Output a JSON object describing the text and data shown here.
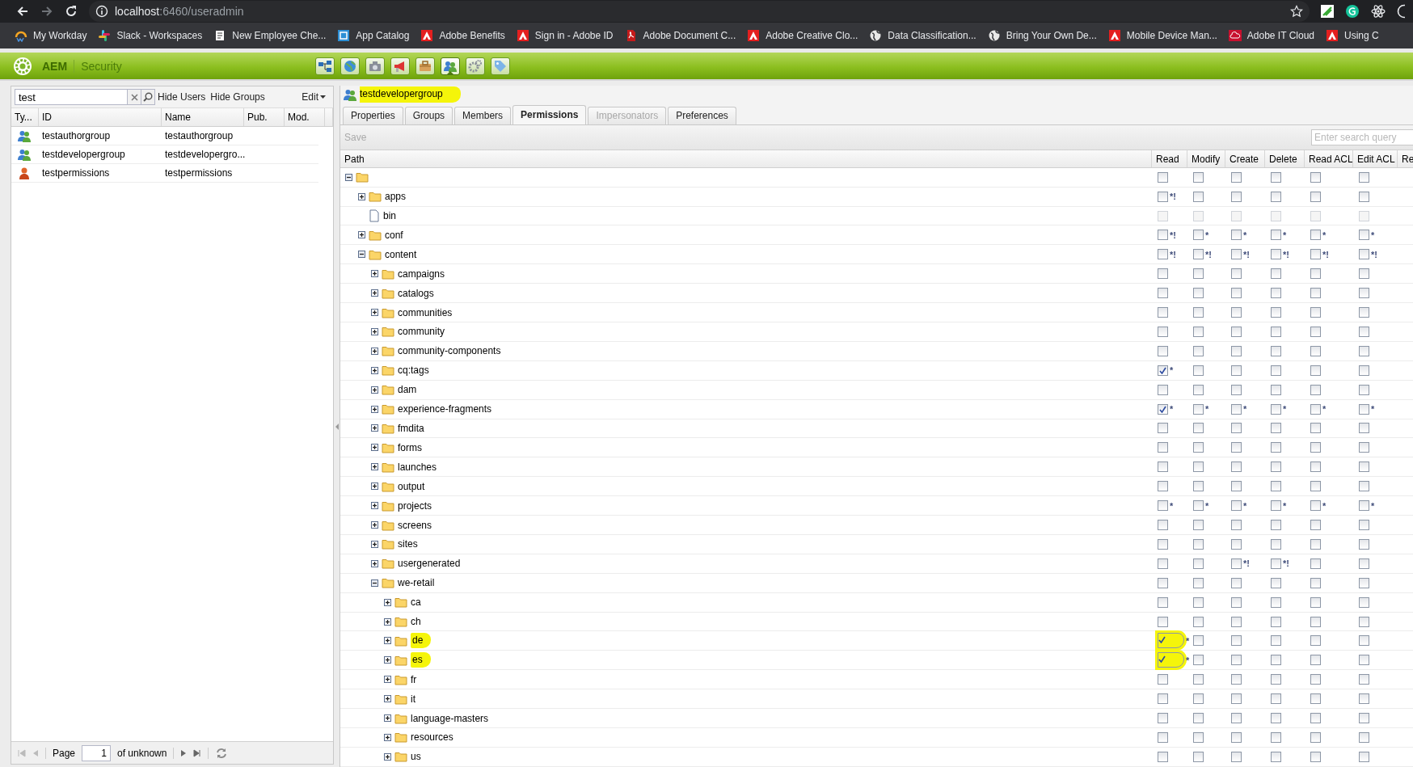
{
  "browser": {
    "url_host": "localhost",
    "url_path": ":6460/useradmin",
    "bookmarks": [
      {
        "label": "My Workday",
        "kind": "workday"
      },
      {
        "label": "Slack - Workspaces",
        "kind": "slack"
      },
      {
        "label": "New Employee Che...",
        "kind": "page"
      },
      {
        "label": "App Catalog",
        "kind": "catalog"
      },
      {
        "label": "Adobe Benefits",
        "kind": "adobe"
      },
      {
        "label": "Sign in - Adobe ID",
        "kind": "adobe"
      },
      {
        "label": "Adobe Document C...",
        "kind": "pdf"
      },
      {
        "label": "Adobe Creative Clo...",
        "kind": "adobe"
      },
      {
        "label": "Data Classification...",
        "kind": "globe"
      },
      {
        "label": "Bring Your Own De...",
        "kind": "globe"
      },
      {
        "label": "Mobile Device Man...",
        "kind": "adobe"
      },
      {
        "label": "Adobe IT Cloud",
        "kind": "cloud"
      },
      {
        "label": "Using C",
        "kind": "adobe"
      }
    ]
  },
  "app_bar": {
    "logo": "AEM",
    "section": "Security",
    "tools": [
      {
        "kind": "network",
        "selected": false
      },
      {
        "kind": "globe",
        "selected": false
      },
      {
        "kind": "camera",
        "selected": false
      },
      {
        "kind": "megaphone",
        "selected": false
      },
      {
        "kind": "envelope",
        "selected": false
      },
      {
        "kind": "users",
        "selected": true
      },
      {
        "kind": "gears",
        "selected": false
      },
      {
        "kind": "tag",
        "selected": false
      }
    ]
  },
  "user_list": {
    "search": {
      "value": "test"
    },
    "filters": [
      "Hide Users",
      "Hide Groups"
    ],
    "edit_menu": "Edit",
    "columns": [
      "Ty...",
      "ID",
      "Name",
      "Pub.",
      "Mod."
    ],
    "rows": [
      {
        "kind": "group",
        "id": "testauthorgroup",
        "name": "testauthorgroup"
      },
      {
        "kind": "group",
        "id": "testdevelopergroup",
        "name": "testdevelopergro..."
      },
      {
        "kind": "user",
        "id": "testpermissions",
        "name": "testpermissions"
      }
    ],
    "pager": {
      "label": "Page",
      "page": "1",
      "total": "of unknown"
    }
  },
  "editor": {
    "title": "testdevelopergroup",
    "title_highlighted": true,
    "tabs": [
      {
        "label": "Properties",
        "selected": false,
        "disabled": false
      },
      {
        "label": "Groups",
        "selected": false,
        "disabled": false
      },
      {
        "label": "Members",
        "selected": false,
        "disabled": false
      },
      {
        "label": "Permissions",
        "selected": true,
        "disabled": false
      },
      {
        "label": "Impersonators",
        "selected": false,
        "disabled": true
      },
      {
        "label": "Preferences",
        "selected": false,
        "disabled": false
      }
    ],
    "save": {
      "label": "Save",
      "disabled": true
    },
    "search": {
      "placeholder": "Enter search query"
    },
    "columns": [
      "Path",
      "Read",
      "Modify",
      "Create",
      "Delete",
      "Read ACL",
      "Edit ACL",
      "Re"
    ],
    "tree": {
      "kind": "folder",
      "expanded": true,
      "highlighted": false,
      "disabled": false,
      "permissions": [
        {
          "checked": false
        },
        {
          "checked": false
        },
        {
          "checked": false
        },
        {
          "checked": false
        },
        {
          "checked": false
        },
        {
          "checked": false
        }
      ],
      "children": [
        {
          "name": "apps",
          "kind": "folder",
          "expanded": false,
          "highlighted": false,
          "disabled": false,
          "permissions": [
            {
              "checked": false,
              "note": "*!"
            },
            {
              "checked": false
            },
            {
              "checked": false
            },
            {
              "checked": false
            },
            {
              "checked": false
            },
            {
              "checked": false
            }
          ]
        },
        {
          "name": "bin",
          "kind": "file",
          "highlighted": false,
          "disabled": true,
          "permissions": [
            {
              "checked": false
            },
            {
              "checked": false
            },
            {
              "checked": false
            },
            {
              "checked": false
            },
            {
              "checked": false
            },
            {
              "checked": false
            }
          ]
        },
        {
          "name": "conf",
          "kind": "folder",
          "expanded": false,
          "highlighted": false,
          "disabled": false,
          "permissions": [
            {
              "checked": false,
              "note": "*!"
            },
            {
              "checked": false,
              "note": "*"
            },
            {
              "checked": false,
              "note": "*"
            },
            {
              "checked": false,
              "note": "*"
            },
            {
              "checked": false,
              "note": "*"
            },
            {
              "checked": false,
              "note": "*"
            }
          ]
        },
        {
          "name": "content",
          "kind": "folder",
          "expanded": true,
          "highlighted": false,
          "disabled": false,
          "permissions": [
            {
              "checked": false,
              "note": "*!"
            },
            {
              "checked": false,
              "note": "*!"
            },
            {
              "checked": false,
              "note": "*!"
            },
            {
              "checked": false,
              "note": "*!"
            },
            {
              "checked": false,
              "note": "*!"
            },
            {
              "checked": false,
              "note": "*!"
            }
          ],
          "children": [
            {
              "name": "campaigns",
              "kind": "folder",
              "expanded": false,
              "highlighted": false,
              "disabled": false,
              "permissions": [
                {
                  "checked": false
                },
                {
                  "checked": false
                },
                {
                  "checked": false
                },
                {
                  "checked": false
                },
                {
                  "checked": false
                },
                {
                  "checked": false
                }
              ]
            },
            {
              "name": "catalogs",
              "kind": "folder",
              "expanded": false,
              "highlighted": false,
              "disabled": false,
              "permissions": [
                {
                  "checked": false
                },
                {
                  "checked": false
                },
                {
                  "checked": false
                },
                {
                  "checked": false
                },
                {
                  "checked": false
                },
                {
                  "checked": false
                }
              ]
            },
            {
              "name": "communities",
              "kind": "folder",
              "expanded": false,
              "highlighted": false,
              "disabled": false,
              "permissions": [
                {
                  "checked": false
                },
                {
                  "checked": false
                },
                {
                  "checked": false
                },
                {
                  "checked": false
                },
                {
                  "checked": false
                },
                {
                  "checked": false
                }
              ]
            },
            {
              "name": "community",
              "kind": "folder",
              "expanded": false,
              "highlighted": false,
              "disabled": false,
              "permissions": [
                {
                  "checked": false
                },
                {
                  "checked": false
                },
                {
                  "checked": false
                },
                {
                  "checked": false
                },
                {
                  "checked": false
                },
                {
                  "checked": false
                }
              ]
            },
            {
              "name": "community-components",
              "kind": "folder",
              "expanded": false,
              "highlighted": false,
              "disabled": false,
              "permissions": [
                {
                  "checked": false
                },
                {
                  "checked": false
                },
                {
                  "checked": false
                },
                {
                  "checked": false
                },
                {
                  "checked": false
                },
                {
                  "checked": false
                }
              ]
            },
            {
              "name": "cq:tags",
              "kind": "folder",
              "expanded": false,
              "highlighted": false,
              "disabled": false,
              "permissions": [
                {
                  "checked": true,
                  "note": "*"
                },
                {
                  "checked": false
                },
                {
                  "checked": false
                },
                {
                  "checked": false
                },
                {
                  "checked": false
                },
                {
                  "checked": false
                }
              ]
            },
            {
              "name": "dam",
              "kind": "folder",
              "expanded": false,
              "highlighted": false,
              "disabled": false,
              "permissions": [
                {
                  "checked": false
                },
                {
                  "checked": false
                },
                {
                  "checked": false
                },
                {
                  "checked": false
                },
                {
                  "checked": false
                },
                {
                  "checked": false
                }
              ]
            },
            {
              "name": "experience-fragments",
              "kind": "folder",
              "expanded": false,
              "highlighted": false,
              "disabled": false,
              "permissions": [
                {
                  "checked": true,
                  "note": "*"
                },
                {
                  "checked": false,
                  "note": "*"
                },
                {
                  "checked": false,
                  "note": "*"
                },
                {
                  "checked": false,
                  "note": "*"
                },
                {
                  "checked": false,
                  "note": "*"
                },
                {
                  "checked": false,
                  "note": "*"
                }
              ]
            },
            {
              "name": "fmdita",
              "kind": "folder",
              "expanded": false,
              "highlighted": false,
              "disabled": false,
              "permissions": [
                {
                  "checked": false
                },
                {
                  "checked": false
                },
                {
                  "checked": false
                },
                {
                  "checked": false
                },
                {
                  "checked": false
                },
                {
                  "checked": false
                }
              ]
            },
            {
              "name": "forms",
              "kind": "folder",
              "expanded": false,
              "highlighted": false,
              "disabled": false,
              "permissions": [
                {
                  "checked": false
                },
                {
                  "checked": false
                },
                {
                  "checked": false
                },
                {
                  "checked": false
                },
                {
                  "checked": false
                },
                {
                  "checked": false
                }
              ]
            },
            {
              "name": "launches",
              "kind": "folder",
              "expanded": false,
              "highlighted": false,
              "disabled": false,
              "permissions": [
                {
                  "checked": false
                },
                {
                  "checked": false
                },
                {
                  "checked": false
                },
                {
                  "checked": false
                },
                {
                  "checked": false
                },
                {
                  "checked": false
                }
              ]
            },
            {
              "name": "output",
              "kind": "folder",
              "expanded": false,
              "highlighted": false,
              "disabled": false,
              "permissions": [
                {
                  "checked": false
                },
                {
                  "checked": false
                },
                {
                  "checked": false
                },
                {
                  "checked": false
                },
                {
                  "checked": false
                },
                {
                  "checked": false
                }
              ]
            },
            {
              "name": "projects",
              "kind": "folder",
              "expanded": false,
              "highlighted": false,
              "disabled": false,
              "permissions": [
                {
                  "checked": false,
                  "note": "*"
                },
                {
                  "checked": false,
                  "note": "*"
                },
                {
                  "checked": false,
                  "note": "*"
                },
                {
                  "checked": false,
                  "note": "*"
                },
                {
                  "checked": false,
                  "note": "*"
                },
                {
                  "checked": false,
                  "note": "*"
                }
              ]
            },
            {
              "name": "screens",
              "kind": "folder",
              "expanded": false,
              "highlighted": false,
              "disabled": false,
              "permissions": [
                {
                  "checked": false
                },
                {
                  "checked": false
                },
                {
                  "checked": false
                },
                {
                  "checked": false
                },
                {
                  "checked": false
                },
                {
                  "checked": false
                }
              ]
            },
            {
              "name": "sites",
              "kind": "folder",
              "expanded": false,
              "highlighted": false,
              "disabled": false,
              "permissions": [
                {
                  "checked": false
                },
                {
                  "checked": false
                },
                {
                  "checked": false
                },
                {
                  "checked": false
                },
                {
                  "checked": false
                },
                {
                  "checked": false
                }
              ]
            },
            {
              "name": "usergenerated",
              "kind": "folder",
              "expanded": false,
              "highlighted": false,
              "disabled": false,
              "permissions": [
                {
                  "checked": false
                },
                {
                  "checked": false
                },
                {
                  "checked": false,
                  "note": "*!"
                },
                {
                  "checked": false,
                  "note": "*!"
                },
                {
                  "checked": false
                },
                {
                  "checked": false
                }
              ]
            },
            {
              "name": "we-retail",
              "kind": "folder",
              "expanded": true,
              "highlighted": false,
              "disabled": false,
              "permissions": [
                {
                  "checked": false
                },
                {
                  "checked": false
                },
                {
                  "checked": false
                },
                {
                  "checked": false
                },
                {
                  "checked": false
                },
                {
                  "checked": false
                }
              ],
              "children": [
                {
                  "name": "ca",
                  "kind": "folder",
                  "expanded": false,
                  "highlighted": false,
                  "disabled": false,
                  "permissions": [
                    {
                      "checked": false
                    },
                    {
                      "checked": false
                    },
                    {
                      "checked": false
                    },
                    {
                      "checked": false
                    },
                    {
                      "checked": false
                    },
                    {
                      "checked": false
                    }
                  ]
                },
                {
                  "name": "ch",
                  "kind": "folder",
                  "expanded": false,
                  "highlighted": false,
                  "disabled": false,
                  "permissions": [
                    {
                      "checked": false
                    },
                    {
                      "checked": false
                    },
                    {
                      "checked": false
                    },
                    {
                      "checked": false
                    },
                    {
                      "checked": false
                    },
                    {
                      "checked": false
                    }
                  ]
                },
                {
                  "name": "de",
                  "kind": "folder",
                  "expanded": false,
                  "highlighted": true,
                  "disabled": false,
                  "permissions": [
                    {
                      "checked": true,
                      "note": "*"
                    },
                    {
                      "checked": false
                    },
                    {
                      "checked": false
                    },
                    {
                      "checked": false
                    },
                    {
                      "checked": false
                    },
                    {
                      "checked": false
                    }
                  ]
                },
                {
                  "name": "es",
                  "kind": "folder",
                  "expanded": false,
                  "highlighted": true,
                  "disabled": false,
                  "permissions": [
                    {
                      "checked": true,
                      "note": "*"
                    },
                    {
                      "checked": false
                    },
                    {
                      "checked": false
                    },
                    {
                      "checked": false
                    },
                    {
                      "checked": false
                    },
                    {
                      "checked": false
                    }
                  ]
                },
                {
                  "name": "fr",
                  "kind": "folder",
                  "expanded": false,
                  "highlighted": false,
                  "disabled": false,
                  "permissions": [
                    {
                      "checked": false
                    },
                    {
                      "checked": false
                    },
                    {
                      "checked": false
                    },
                    {
                      "checked": false
                    },
                    {
                      "checked": false
                    },
                    {
                      "checked": false
                    }
                  ]
                },
                {
                  "name": "it",
                  "kind": "folder",
                  "expanded": false,
                  "highlighted": false,
                  "disabled": false,
                  "permissions": [
                    {
                      "checked": false
                    },
                    {
                      "checked": false
                    },
                    {
                      "checked": false
                    },
                    {
                      "checked": false
                    },
                    {
                      "checked": false
                    },
                    {
                      "checked": false
                    }
                  ]
                },
                {
                  "name": "language-masters",
                  "kind": "folder",
                  "expanded": false,
                  "highlighted": false,
                  "disabled": false,
                  "permissions": [
                    {
                      "checked": false
                    },
                    {
                      "checked": false
                    },
                    {
                      "checked": false
                    },
                    {
                      "checked": false
                    },
                    {
                      "checked": false
                    },
                    {
                      "checked": false
                    }
                  ]
                },
                {
                  "name": "resources",
                  "kind": "folder",
                  "expanded": false,
                  "highlighted": false,
                  "disabled": false,
                  "permissions": [
                    {
                      "checked": false
                    },
                    {
                      "checked": false
                    },
                    {
                      "checked": false
                    },
                    {
                      "checked": false
                    },
                    {
                      "checked": false
                    },
                    {
                      "checked": false
                    }
                  ]
                },
                {
                  "name": "us",
                  "kind": "folder",
                  "expanded": false,
                  "highlighted": false,
                  "disabled": false,
                  "permissions": [
                    {
                      "checked": false
                    },
                    {
                      "checked": false
                    },
                    {
                      "checked": false
                    },
                    {
                      "checked": false
                    },
                    {
                      "checked": false
                    },
                    {
                      "checked": false
                    }
                  ]
                }
              ]
            }
          ]
        }
      ]
    }
  }
}
